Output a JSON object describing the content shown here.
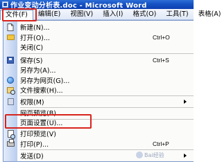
{
  "window": {
    "title": "作业变动分析表.doc - Microsoft Word"
  },
  "menubar": {
    "items": [
      "文件(F)",
      "编辑(E)",
      "视图(V)",
      "插入(I)",
      "格式(O)",
      "工具(T)",
      "表格(A)"
    ]
  },
  "file_menu": {
    "items": [
      {
        "label": "新建(N)...",
        "shortcut": "",
        "icon": "new-document-icon"
      },
      {
        "label": "打开(O)...",
        "shortcut": "Ctrl+O",
        "icon": "open-folder-icon"
      },
      {
        "label": "关闭(C)",
        "shortcut": "",
        "icon": ""
      },
      {
        "label": "保存(S)",
        "shortcut": "Ctrl+S",
        "icon": "save-disk-icon"
      },
      {
        "label": "另存为(A)...",
        "shortcut": "",
        "icon": ""
      },
      {
        "label": "另存为网页(G)...",
        "shortcut": "",
        "icon": "web-page-icon"
      },
      {
        "label": "文件搜索(H)...",
        "shortcut": "",
        "icon": "file-search-icon"
      },
      {
        "label": "权限(M)",
        "shortcut": "",
        "icon": "permission-icon"
      },
      {
        "label": "网页预览(B)",
        "shortcut": "",
        "icon": ""
      },
      {
        "label": "页面设置(U)...",
        "shortcut": "",
        "icon": ""
      },
      {
        "label": "打印预览(V)",
        "shortcut": "",
        "icon": "print-preview-icon"
      },
      {
        "label": "打印(P)...",
        "shortcut": "Ctrl+P",
        "icon": "printer-icon"
      },
      {
        "label": "发送(D)",
        "shortcut": "",
        "icon": ""
      }
    ]
  },
  "watermark": {
    "text": "Bai经验"
  },
  "colors": {
    "title_bar": "#1552c4",
    "menubar_bg": "#dfe8f7",
    "highlight_box": "#d8231b"
  }
}
